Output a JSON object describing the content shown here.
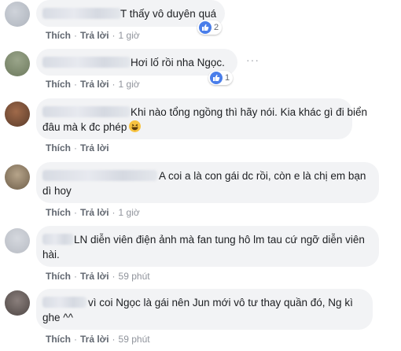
{
  "action_like": "Thích",
  "action_reply": "Trả lời",
  "separator": "·",
  "comments": [
    {
      "text_lines": [
        "T thấy vô duyên quá"
      ],
      "time": "1 giờ",
      "reactions": "2"
    },
    {
      "text_lines": [
        "Hơi lố rồi nha Ngọc."
      ],
      "time": "1 giờ",
      "reactions": "1"
    },
    {
      "text_lines": [
        "Khi nào tổng ngồng thì hãy nói. Kia khác gì đi biển",
        "đâu mà k đc phép"
      ],
      "time": "",
      "emoji": "grinning-squint-face"
    },
    {
      "text_lines": [
        "A coi a là con gái dc rồi, còn e là chị em bạn",
        "dì hoy"
      ],
      "time": "1 giờ"
    },
    {
      "text_lines": [
        "LN diễn viên điện ảnh mà fan tung hô lm tau cứ ngỡ diễn viên",
        "hài."
      ],
      "time": "59 phút"
    },
    {
      "text_lines": [
        "vì coi Ngọc là gái nên Jun mới vô tư thay quần đó, Ng kì",
        "ghe ^^"
      ],
      "time": "59 phút"
    }
  ],
  "more_icon": "more-horizontal-icon",
  "colors": {
    "bubble": "#f2f3f5",
    "like_blue": "#4a7eea",
    "action_gray": "#616770"
  }
}
